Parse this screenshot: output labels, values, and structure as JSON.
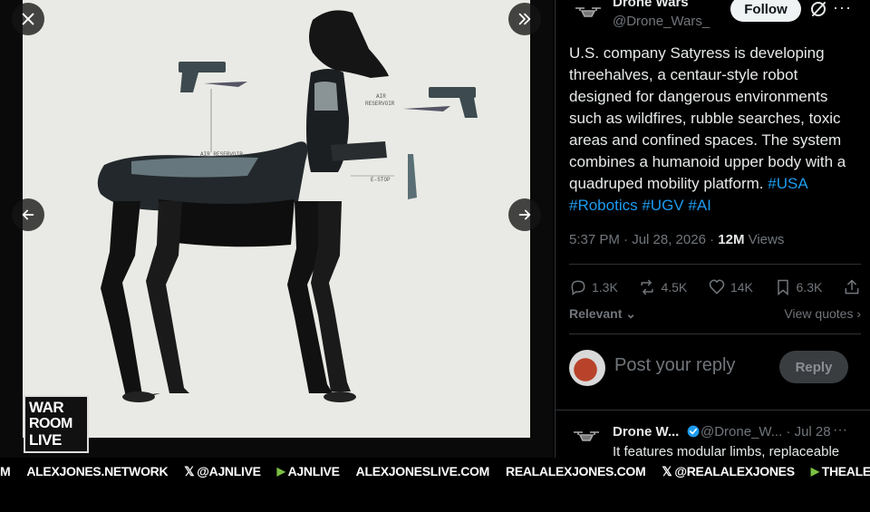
{
  "viewer": {
    "close_icon": "close-icon",
    "next_icon": "double-chevron-right-icon",
    "prev_icon": "arrow-left-icon",
    "forward_icon": "arrow-right-icon"
  },
  "photo": {
    "label_air_reservoir_body": "AIR RESERVOIR",
    "label_air_reservoir_arm": "AIR\nRESERVOIR",
    "label_estop": "E-STOP"
  },
  "logo": {
    "line1": "WAR",
    "line2": "ROOM",
    "line3": "LIVE"
  },
  "tweet": {
    "author_name": "Drone Wars",
    "author_handle": "@Drone_Wars_",
    "follow_label": "Follow",
    "text_main": "U.S. company Satyress is developing threehalves, a centaur-style robot designed for dangerous environments such as wildfires, rubble searches, toxic areas and confined spaces. The system combines a humanoid upper body with a quadruped mobility platform.",
    "hashtags": [
      "#USA",
      "#Robotics",
      "#UGV",
      "#AI"
    ],
    "time": "5:37 PM · Jul 28, 2026 · ",
    "views_count": "12M",
    "views_label": " Views",
    "replies": "1.3K",
    "reposts": "4.5K",
    "likes": "14K",
    "bookmarks": "6.3K",
    "relevant_label": "Relevant",
    "view_quotes_label": "View quotes",
    "reply_placeholder": "Post your reply",
    "reply_button": "Reply"
  },
  "reply2": {
    "name": "Drone W...",
    "handle": "@Drone_W... · Jul 28",
    "text": "It features modular limbs, replaceable"
  },
  "ticker": [
    {
      "text": "M",
      "icon": ""
    },
    {
      "text": "ALEXJONES.NETWORK",
      "icon": ""
    },
    {
      "text": "@AJNLIVE",
      "icon": "x"
    },
    {
      "text": "AJNLIVE",
      "icon": "rumble"
    },
    {
      "text": "ALEXJONESLIVE.COM",
      "icon": ""
    },
    {
      "text": "REALALEXJONES.COM",
      "icon": ""
    },
    {
      "text": "@REALALEXJONES",
      "icon": "x"
    },
    {
      "text": "THEALEXJONES",
      "icon": "rumble"
    }
  ],
  "colors": {
    "link": "#1d9bf0",
    "muted": "#71767b",
    "text": "#e7e9ea",
    "rumble": "#7bc043"
  }
}
